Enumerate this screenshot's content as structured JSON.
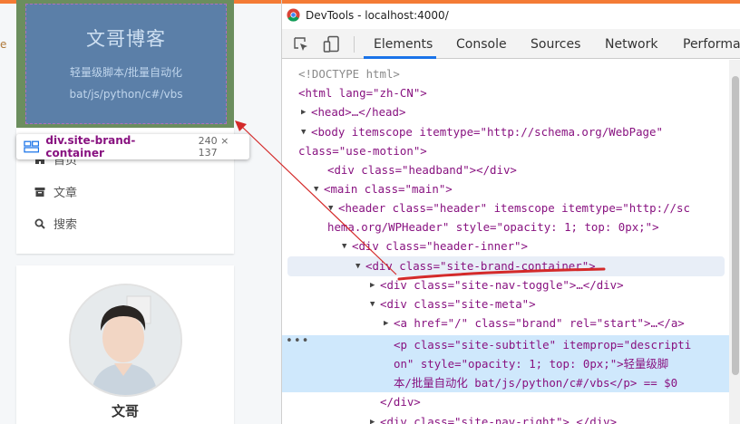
{
  "blog": {
    "edge_letter": "e",
    "brand_title": "文哥博客",
    "brand_subtitle": "轻量级脚本/批量自动化",
    "brand_langs": "bat/js/python/c#/vbs",
    "inspect_tooltip": {
      "selector": "div.site-brand-container",
      "size": "240 × 137",
      "icon": "element-box-icon"
    },
    "menu": [
      {
        "label": "首页",
        "icon": "home-icon"
      },
      {
        "label": "文章",
        "icon": "archive-icon"
      },
      {
        "label": "搜索",
        "icon": "search-icon"
      }
    ],
    "author": {
      "name": "文哥",
      "avatar": "author-avatar"
    }
  },
  "devtools": {
    "window_title": "DevTools - localhost:4000/",
    "tabs": [
      "Elements",
      "Console",
      "Sources",
      "Network",
      "Performar"
    ],
    "active_tab": "Elements",
    "colors": {
      "accent": "#1a73e8",
      "tag": "#881280",
      "attr": "#994500",
      "value": "#1a1aa6",
      "selection": "#cfe8fc"
    },
    "tree": {
      "doctype": "<!DOCTYPE html>",
      "html_open": "<html lang=\"zh-CN\">",
      "head": "<head>…</head>",
      "body_l1": "<body itemscope itemtype=\"http://schema.org/WebPage\"",
      "body_l2": "class=\"use-motion\">",
      "headband": "<div class=\"headband\"></div>",
      "main": "<main class=\"main\">",
      "header_l1": "<header class=\"header\" itemscope itemtype=\"http://sc",
      "header_l2": "hema.org/WPHeader\" style=\"opacity: 1; top: 0px;\">",
      "header_inner": "<div class=\"header-inner\">",
      "brand_container": "<div class=\"site-brand-container\">",
      "nav_toggle": "<div class=\"site-nav-toggle\">…</div>",
      "site_meta": "<div class=\"site-meta\">",
      "brand_link": "<a href=\"/\" class=\"brand\" rel=\"start\">…</a>",
      "subtitle_l1": "<p class=\"site-subtitle\" itemprop=\"descripti",
      "subtitle_l2": "on\" style=\"opacity: 1; top: 0px;\">轻量级脚",
      "subtitle_l3": "本/批量自动化 bat/js/python/c#/vbs</p> == $0",
      "close_div": "</div>",
      "nav_right": "<div class=\"site-nav-right\">…</div>"
    }
  }
}
